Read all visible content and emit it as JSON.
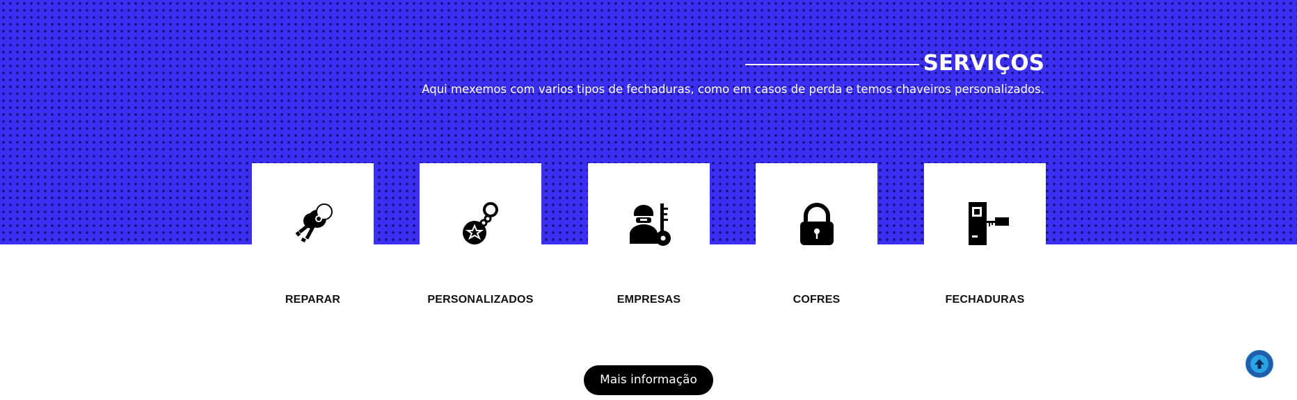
{
  "section": {
    "title": "SERVIÇOS",
    "subtitle": "Aqui mexemos com varios tipos de fechaduras, como em casos de perda e temos chaveiros personalizados."
  },
  "services": [
    {
      "label": "REPARAR",
      "icon": "keys-icon"
    },
    {
      "label": "PERSONALIZADOS",
      "icon": "keychain-icon"
    },
    {
      "label": "EMPRESAS",
      "icon": "locksmith-worker-icon"
    },
    {
      "label": "COFRES",
      "icon": "padlock-icon"
    },
    {
      "label": "FECHADURAS",
      "icon": "door-lock-icon"
    }
  ],
  "actions": {
    "more_info_label": "Mais informação",
    "scroll_top_icon": "arrow-up-icon"
  },
  "colors": {
    "hero_background": "#3b30f2",
    "button_background": "#000000",
    "scroll_button": "#1f5ea8"
  }
}
